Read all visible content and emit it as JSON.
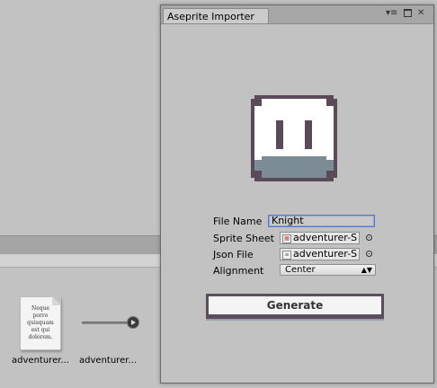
{
  "project_assets": [
    {
      "name": "adventurer...",
      "kind": "text-document",
      "preview_text": "Neque porro quisquam est qui dolorem."
    },
    {
      "name": "adventurer...",
      "kind": "audio"
    }
  ],
  "importer": {
    "tab_title": "Aseprite Importer",
    "fields": {
      "file_name_label": "File Name",
      "file_name_value": "Knight",
      "sprite_sheet_label": "Sprite Sheet",
      "sprite_sheet_value": "adventurer-S",
      "json_file_label": "Json File",
      "json_file_value": "adventurer-S",
      "alignment_label": "Alignment",
      "alignment_value": "Center"
    },
    "generate_label": "Generate"
  },
  "colors": {
    "sprite_outline": "#5b4b5a",
    "sprite_face": "#ffffff",
    "sprite_chin": "#7b8c96",
    "focus_border": "#5a78c8"
  }
}
